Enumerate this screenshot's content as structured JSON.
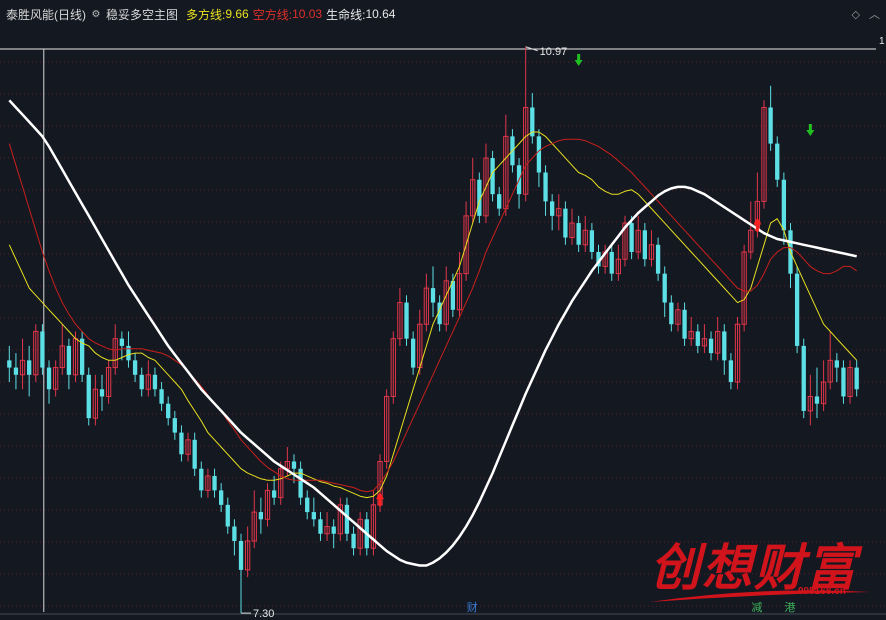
{
  "header": {
    "stock_name": "泰胜风能(日线)",
    "indicator_name": "稳妥多空主图",
    "series": [
      {
        "label": "多方线:",
        "value": "9.66",
        "color": "#e8e020"
      },
      {
        "label": "空方线:",
        "value": "10.03",
        "color": "#e0302a"
      },
      {
        "label": "生命线:",
        "value": "10.64",
        "color": "#e8e8e8"
      }
    ]
  },
  "annotations": {
    "high_label": "10.97",
    "low_label": "7.30",
    "edge_label": "1",
    "bottom_markers": [
      "财",
      "减",
      "港"
    ]
  },
  "watermark": {
    "text": "创想财富",
    "url": "995168.cn"
  },
  "colors": {
    "background": "#141821",
    "up": "#e0364a",
    "down": "#5ce0e6",
    "up_arrow": "#ff2020",
    "down_arrow": "#20c020",
    "long_line": "#e8e020",
    "short_line": "#c8201c",
    "life_line": "#ffffff"
  },
  "chart_data": {
    "type": "candlestick",
    "ylim": [
      7.1,
      11.1
    ],
    "candles": [
      [
        8.8,
        8.75,
        8.9,
        8.65
      ],
      [
        8.75,
        8.7,
        8.85,
        8.6
      ],
      [
        8.7,
        8.8,
        8.95,
        8.6
      ],
      [
        8.8,
        8.7,
        8.9,
        8.55
      ],
      [
        8.7,
        9.0,
        9.05,
        8.65
      ],
      [
        9.0,
        8.75,
        9.05,
        8.7
      ],
      [
        8.75,
        8.6,
        8.8,
        8.5
      ],
      [
        8.6,
        8.75,
        8.8,
        8.55
      ],
      [
        8.75,
        8.9,
        9.05,
        8.7
      ],
      [
        8.9,
        8.7,
        8.95,
        8.6
      ],
      [
        8.7,
        8.95,
        9.0,
        8.65
      ],
      [
        8.95,
        8.7,
        9.0,
        8.65
      ],
      [
        8.7,
        8.4,
        8.75,
        8.35
      ],
      [
        8.4,
        8.6,
        8.7,
        8.35
      ],
      [
        8.6,
        8.55,
        8.7,
        8.45
      ],
      [
        8.55,
        8.75,
        8.8,
        8.5
      ],
      [
        8.75,
        8.95,
        9.05,
        8.7
      ],
      [
        8.95,
        8.9,
        9.0,
        8.8
      ],
      [
        8.9,
        8.8,
        9.0,
        8.75
      ],
      [
        8.8,
        8.7,
        8.85,
        8.65
      ],
      [
        8.7,
        8.6,
        8.75,
        8.55
      ],
      [
        8.6,
        8.7,
        8.8,
        8.55
      ],
      [
        8.7,
        8.6,
        8.75,
        8.55
      ],
      [
        8.6,
        8.5,
        8.65,
        8.45
      ],
      [
        8.5,
        8.4,
        8.55,
        8.35
      ],
      [
        8.4,
        8.3,
        8.45,
        8.25
      ],
      [
        8.3,
        8.15,
        8.35,
        8.1
      ],
      [
        8.15,
        8.25,
        8.3,
        8.1
      ],
      [
        8.25,
        8.05,
        8.3,
        8.0
      ],
      [
        8.05,
        7.9,
        8.1,
        7.85
      ],
      [
        7.9,
        8.0,
        8.05,
        7.85
      ],
      [
        8.0,
        7.9,
        8.05,
        7.85
      ],
      [
        7.9,
        7.8,
        7.95,
        7.75
      ],
      [
        7.8,
        7.65,
        7.85,
        7.6
      ],
      [
        7.65,
        7.55,
        7.7,
        7.45
      ],
      [
        7.55,
        7.35,
        7.6,
        7.3
      ],
      [
        7.35,
        7.55,
        7.65,
        7.3
      ],
      [
        7.55,
        7.75,
        7.9,
        7.5
      ],
      [
        7.75,
        7.7,
        7.85,
        7.6
      ],
      [
        7.7,
        7.9,
        7.95,
        7.65
      ],
      [
        7.9,
        7.85,
        8.0,
        7.8
      ],
      [
        7.85,
        8.05,
        8.1,
        7.8
      ],
      [
        8.05,
        8.1,
        8.2,
        8.0
      ],
      [
        8.1,
        8.05,
        8.15,
        7.95
      ],
      [
        8.05,
        7.85,
        8.1,
        7.8
      ],
      [
        7.85,
        7.75,
        7.9,
        7.7
      ],
      [
        7.75,
        7.7,
        7.85,
        7.65
      ],
      [
        7.7,
        7.6,
        7.75,
        7.55
      ],
      [
        7.6,
        7.65,
        7.75,
        7.55
      ],
      [
        7.65,
        7.6,
        7.7,
        7.5
      ],
      [
        7.6,
        7.8,
        7.85,
        7.55
      ],
      [
        7.8,
        7.6,
        7.85,
        7.55
      ],
      [
        7.6,
        7.5,
        7.65,
        7.45
      ],
      [
        7.5,
        7.7,
        7.75,
        7.45
      ],
      [
        7.7,
        7.5,
        7.75,
        7.45
      ],
      [
        7.5,
        7.8,
        7.9,
        7.45
      ],
      [
        7.8,
        8.1,
        8.15,
        7.75
      ],
      [
        8.1,
        8.55,
        8.6,
        8.05
      ],
      [
        8.55,
        8.95,
        9.0,
        8.5
      ],
      [
        8.95,
        9.2,
        9.3,
        8.9
      ],
      [
        9.2,
        8.95,
        9.25,
        8.9
      ],
      [
        8.95,
        8.75,
        9.0,
        8.7
      ],
      [
        8.75,
        9.05,
        9.15,
        8.7
      ],
      [
        9.05,
        9.3,
        9.4,
        9.0
      ],
      [
        9.3,
        9.2,
        9.45,
        9.1
      ],
      [
        9.2,
        9.05,
        9.25,
        9.0
      ],
      [
        9.05,
        9.35,
        9.45,
        9.0
      ],
      [
        9.35,
        9.15,
        9.4,
        9.1
      ],
      [
        9.15,
        9.4,
        9.55,
        9.1
      ],
      [
        9.4,
        9.8,
        9.9,
        9.35
      ],
      [
        9.8,
        10.05,
        10.2,
        9.75
      ],
      [
        10.05,
        9.8,
        10.1,
        9.75
      ],
      [
        9.8,
        10.2,
        10.3,
        9.75
      ],
      [
        10.2,
        9.95,
        10.25,
        9.9
      ],
      [
        9.95,
        9.85,
        10.0,
        9.8
      ],
      [
        9.85,
        10.35,
        10.5,
        9.8
      ],
      [
        10.35,
        10.15,
        10.4,
        10.1
      ],
      [
        10.15,
        9.95,
        10.2,
        9.85
      ],
      [
        9.95,
        10.55,
        10.97,
        9.9
      ],
      [
        10.55,
        10.35,
        10.65,
        10.3
      ],
      [
        10.35,
        10.1,
        10.4,
        10.0
      ],
      [
        10.1,
        9.9,
        10.15,
        9.8
      ],
      [
        9.9,
        9.8,
        9.95,
        9.7
      ],
      [
        9.8,
        9.85,
        9.95,
        9.7
      ],
      [
        9.85,
        9.65,
        9.9,
        9.6
      ],
      [
        9.65,
        9.75,
        9.85,
        9.6
      ],
      [
        9.75,
        9.6,
        9.8,
        9.55
      ],
      [
        9.6,
        9.7,
        9.8,
        9.55
      ],
      [
        9.7,
        9.55,
        9.75,
        9.5
      ],
      [
        9.55,
        9.45,
        9.6,
        9.4
      ],
      [
        9.45,
        9.55,
        9.6,
        9.4
      ],
      [
        9.55,
        9.4,
        9.6,
        9.35
      ],
      [
        9.4,
        9.5,
        9.6,
        9.35
      ],
      [
        9.5,
        9.75,
        9.8,
        9.45
      ],
      [
        9.75,
        9.55,
        9.8,
        9.5
      ],
      [
        9.55,
        9.7,
        9.8,
        9.5
      ],
      [
        9.7,
        9.5,
        9.75,
        9.45
      ],
      [
        9.5,
        9.6,
        9.7,
        9.45
      ],
      [
        9.6,
        9.4,
        9.65,
        9.35
      ],
      [
        9.4,
        9.2,
        9.45,
        9.1
      ],
      [
        9.2,
        9.05,
        9.25,
        9.0
      ],
      [
        9.05,
        9.15,
        9.2,
        9.0
      ],
      [
        9.15,
        8.95,
        9.2,
        8.9
      ],
      [
        8.95,
        9.0,
        9.1,
        8.9
      ],
      [
        9.0,
        8.9,
        9.05,
        8.85
      ],
      [
        8.9,
        8.95,
        9.05,
        8.85
      ],
      [
        8.95,
        8.85,
        9.0,
        8.8
      ],
      [
        8.85,
        9.0,
        9.1,
        8.8
      ],
      [
        9.0,
        8.8,
        9.05,
        8.7
      ],
      [
        8.8,
        8.65,
        8.85,
        8.6
      ],
      [
        8.65,
        9.05,
        9.1,
        8.6
      ],
      [
        9.05,
        9.55,
        9.6,
        9.0
      ],
      [
        9.55,
        9.7,
        9.9,
        9.5
      ],
      [
        9.7,
        9.9,
        10.1,
        9.65
      ],
      [
        9.9,
        10.55,
        10.6,
        9.85
      ],
      [
        10.55,
        10.3,
        10.7,
        10.25
      ],
      [
        10.3,
        10.05,
        10.35,
        10.0
      ],
      [
        10.05,
        9.7,
        10.1,
        9.6
      ],
      [
        9.7,
        9.4,
        9.75,
        9.3
      ],
      [
        9.4,
        8.9,
        9.45,
        8.85
      ],
      [
        8.9,
        8.45,
        8.95,
        8.4
      ],
      [
        8.45,
        8.55,
        8.7,
        8.35
      ],
      [
        8.55,
        8.5,
        8.75,
        8.4
      ],
      [
        8.5,
        8.65,
        8.8,
        8.45
      ],
      [
        8.65,
        8.8,
        9.0,
        8.6
      ],
      [
        8.8,
        8.75,
        8.85,
        8.65
      ],
      [
        8.75,
        8.55,
        8.8,
        8.5
      ],
      [
        8.55,
        8.75,
        8.8,
        8.5
      ],
      [
        8.75,
        8.6,
        8.8,
        8.55
      ]
    ],
    "long_line": [
      9.6,
      9.5,
      9.4,
      9.3,
      9.25,
      9.2,
      9.15,
      9.1,
      9.05,
      9.0,
      8.95,
      8.92,
      8.9,
      8.85,
      8.82,
      8.8,
      8.8,
      8.82,
      8.84,
      8.85,
      8.85,
      8.82,
      8.8,
      8.75,
      8.7,
      8.65,
      8.6,
      8.52,
      8.45,
      8.38,
      8.3,
      8.25,
      8.2,
      8.15,
      8.1,
      8.05,
      8.02,
      8.0,
      7.98,
      7.97,
      7.97,
      7.98,
      8.0,
      8.02,
      8.02,
      8.0,
      7.98,
      7.96,
      7.95,
      7.93,
      7.92,
      7.9,
      7.88,
      7.86,
      7.85,
      7.86,
      7.9,
      8.0,
      8.15,
      8.3,
      8.45,
      8.6,
      8.75,
      8.9,
      9.05,
      9.15,
      9.25,
      9.35,
      9.45,
      9.6,
      9.75,
      9.9,
      10.0,
      10.1,
      10.15,
      10.2,
      10.25,
      10.3,
      10.35,
      10.38,
      10.38,
      10.35,
      10.3,
      10.25,
      10.2,
      10.15,
      10.1,
      10.08,
      10.05,
      10.0,
      9.97,
      9.95,
      9.95,
      9.97,
      9.98,
      9.95,
      9.9,
      9.85,
      9.8,
      9.75,
      9.7,
      9.65,
      9.6,
      9.55,
      9.5,
      9.45,
      9.4,
      9.35,
      9.3,
      9.25,
      9.2,
      9.22,
      9.3,
      9.45,
      9.6,
      9.75,
      9.78,
      9.7,
      9.55,
      9.45,
      9.35,
      9.25,
      9.15,
      9.05,
      9.0,
      8.95,
      8.9,
      8.85,
      8.8
    ],
    "short_line": [
      10.3,
      10.15,
      10.0,
      9.85,
      9.7,
      9.55,
      9.42,
      9.3,
      9.2,
      9.12,
      9.05,
      9.0,
      8.95,
      8.92,
      8.9,
      8.88,
      8.87,
      8.88,
      8.88,
      8.88,
      8.88,
      8.87,
      8.86,
      8.85,
      8.83,
      8.8,
      8.77,
      8.72,
      8.67,
      8.62,
      8.56,
      8.5,
      8.45,
      8.38,
      8.32,
      8.25,
      8.2,
      8.15,
      8.1,
      8.06,
      8.03,
      8.0,
      7.98,
      7.97,
      7.97,
      7.97,
      7.97,
      7.97,
      7.96,
      7.95,
      7.94,
      7.93,
      7.92,
      7.9,
      7.89,
      7.9,
      7.95,
      8.02,
      8.1,
      8.2,
      8.3,
      8.4,
      8.5,
      8.6,
      8.7,
      8.8,
      8.9,
      9.0,
      9.1,
      9.2,
      9.3,
      9.42,
      9.55,
      9.65,
      9.75,
      9.85,
      9.95,
      10.05,
      10.15,
      10.2,
      10.25,
      10.28,
      10.3,
      10.32,
      10.33,
      10.33,
      10.33,
      10.32,
      10.3,
      10.28,
      10.25,
      10.22,
      10.18,
      10.14,
      10.1,
      10.05,
      10.0,
      9.95,
      9.9,
      9.85,
      9.8,
      9.75,
      9.7,
      9.65,
      9.6,
      9.55,
      9.5,
      9.45,
      9.4,
      9.35,
      9.3,
      9.28,
      9.28,
      9.32,
      9.4,
      9.5,
      9.55,
      9.58,
      9.58,
      9.55,
      9.5,
      9.45,
      9.42,
      9.4,
      9.4,
      9.42,
      9.45,
      9.45,
      9.42
    ],
    "life_line": [
      10.6,
      10.55,
      10.5,
      10.45,
      10.4,
      10.35,
      10.28,
      10.2,
      10.12,
      10.04,
      9.96,
      9.88,
      9.8,
      9.72,
      9.64,
      9.56,
      9.48,
      9.4,
      9.32,
      9.25,
      9.18,
      9.11,
      9.04,
      8.97,
      8.9,
      8.84,
      8.78,
      8.72,
      8.66,
      8.6,
      8.55,
      8.5,
      8.45,
      8.4,
      8.35,
      8.3,
      8.26,
      8.22,
      8.18,
      8.14,
      8.1,
      8.07,
      8.04,
      8.01,
      7.98,
      7.95,
      7.92,
      7.88,
      7.84,
      7.8,
      7.76,
      7.72,
      7.68,
      7.64,
      7.6,
      7.56,
      7.52,
      7.48,
      7.45,
      7.42,
      7.4,
      7.39,
      7.38,
      7.38,
      7.4,
      7.43,
      7.47,
      7.52,
      7.58,
      7.65,
      7.73,
      7.82,
      7.92,
      8.02,
      8.13,
      8.24,
      8.35,
      8.46,
      8.57,
      8.67,
      8.77,
      8.87,
      8.96,
      9.05,
      9.13,
      9.21,
      9.28,
      9.35,
      9.42,
      9.48,
      9.54,
      9.6,
      9.66,
      9.72,
      9.77,
      9.82,
      9.86,
      9.9,
      9.94,
      9.97,
      9.99,
      10.0,
      10.0,
      9.99,
      9.97,
      9.95,
      9.92,
      9.89,
      9.86,
      9.83,
      9.8,
      9.77,
      9.74,
      9.71,
      9.68,
      9.66,
      9.64,
      9.63,
      9.62,
      9.61,
      9.6,
      9.59,
      9.58,
      9.57,
      9.56,
      9.55,
      9.54,
      9.53,
      9.52
    ],
    "up_arrows": [
      56,
      113
    ],
    "down_arrows": [
      86,
      121
    ],
    "high_index": 78,
    "low_index": 35,
    "crosshair_index": 4,
    "marker_index": [
      70,
      113,
      118
    ]
  }
}
